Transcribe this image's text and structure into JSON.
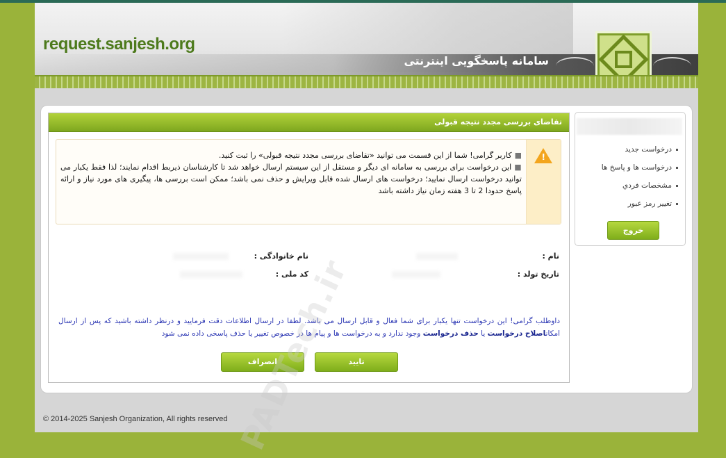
{
  "header": {
    "site_url": "request.sanjesh.org",
    "system_title": "سامانه پاسخگویی اینترنتی"
  },
  "sidebar": {
    "items": [
      {
        "label": "درخواست جدید"
      },
      {
        "label": "درخواست ها و پاسخ ها"
      },
      {
        "label": "مشخصات فردي"
      },
      {
        "label": "تغيير رمز عبور"
      }
    ],
    "logout_label": "خروج"
  },
  "main": {
    "title": "تقاضای بررسی مجدد نتیجه قبولی",
    "notice": {
      "line1": "کاربر گرامی! شما از این قسمت می توانید «تقاضای بررسی مجدد نتیجه قبولی» را ثبت کنید.",
      "line2": "این درخواست برای بررسی به سامانه ای دیگر و مستقل از این سیستم ارسال خواهد شد تا کارشناسان ذیربط اقدام نمایند؛ لذا فقط یکبار می توانید درخواست ارسال نمایید؛ درخواست های ارسال شده قابل ویرایش و حذف نمی باشد؛ ممکن است بررسی ها، پیگیری های مورد نیاز و ارائه پاسخ حدودا 2 تا 3 هفته زمان نیاز داشته باشد"
    },
    "fields": {
      "name_label": "نام :",
      "family_label": "نام خانوادگی :",
      "birth_label": "تاریخ تولد :",
      "nid_label": "کد ملی :"
    },
    "info": {
      "part1": "داوطلب گرامی! این درخواست تنها یکبار برای شما فعال و قابل ارسال می باشد. لطفا در ارسال اطلاعات دقت فرمایید و درنظر داشته باشید که پس از ارسال امکان",
      "bold1": "اصلاح درخواست",
      "part2": " یا ",
      "bold2": "حذف درخواست",
      "part3": " وجود ندارد و به درخواست ها و پیام ها در خصوص تغییر یا حذف پاسخی داده نمی شود"
    },
    "confirm_label": "تایید",
    "cancel_label": "انصراف"
  },
  "footer": {
    "copyright": "© 2014-2025 Sanjesh Organization, All rights reserved"
  },
  "watermark": "PADTech.ir"
}
